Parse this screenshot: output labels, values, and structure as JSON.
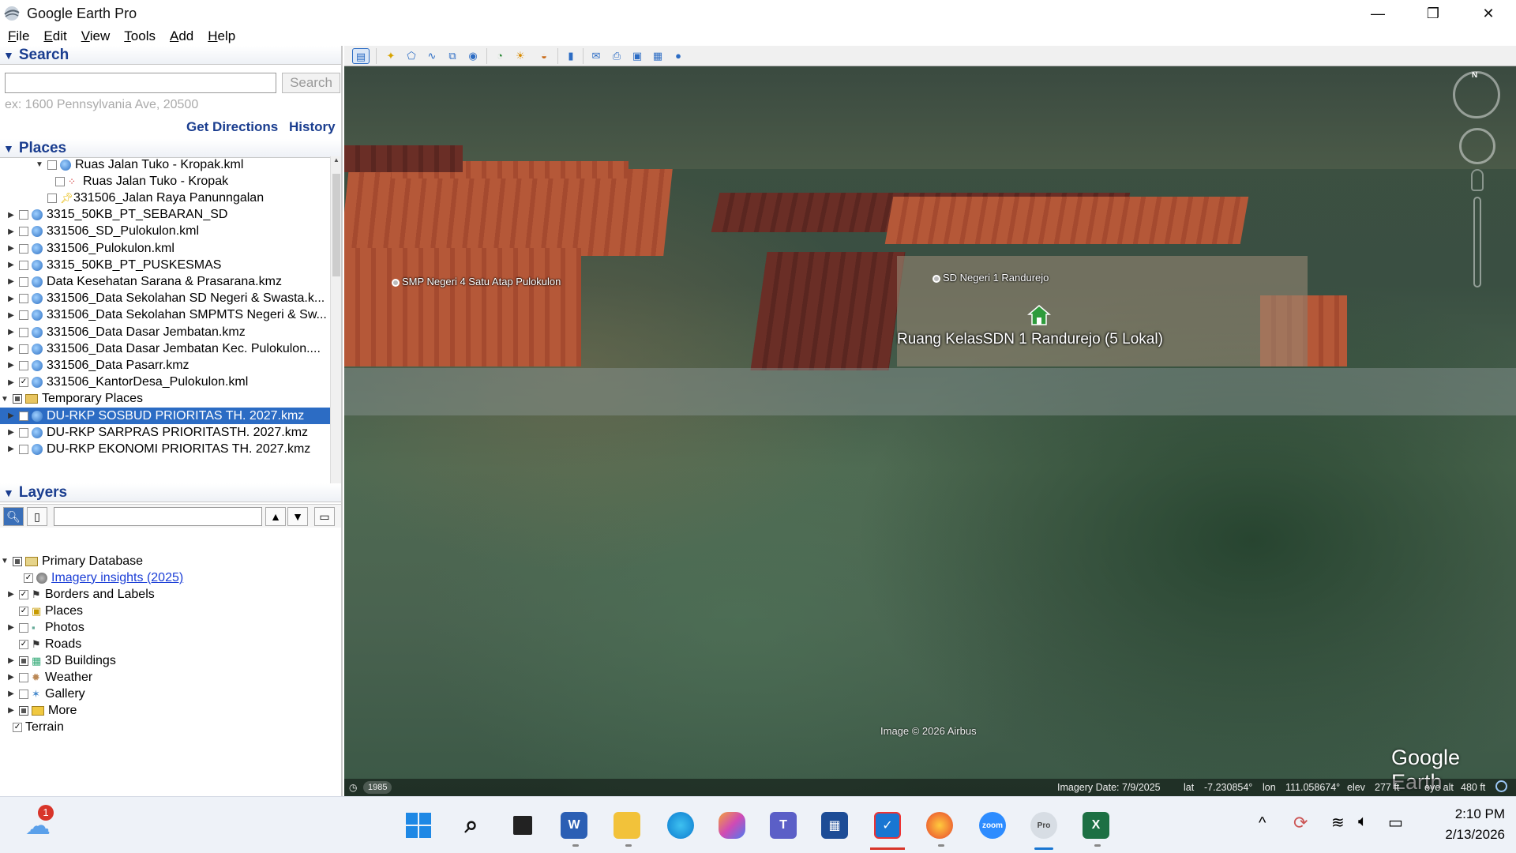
{
  "window": {
    "title": "Google Earth Pro",
    "minimize_glyph": "—",
    "maximize_glyph": "❐",
    "close_glyph": "✕"
  },
  "menu": [
    "File",
    "Edit",
    "View",
    "Tools",
    "Add",
    "Help"
  ],
  "search": {
    "header": "Search",
    "button": "Search",
    "placeholder": "ex: 1600 Pennsylvania Ave, 20500",
    "get_directions": "Get Directions",
    "history": "History"
  },
  "places": {
    "header": "Places",
    "items": [
      {
        "label": "Ruas Jalan Tuko - Kropak.kml",
        "icon": "kml-icon",
        "check": "off",
        "expand": "open"
      },
      {
        "label": "Ruas Jalan Tuko - Kropak",
        "icon": "path-icon",
        "check": "off",
        "expand": "none"
      },
      {
        "label": "331506_Jalan Raya Panunngalan",
        "icon": "pushpin-icon",
        "check": "off",
        "expand": "none"
      },
      {
        "label": "3315_50KB_PT_SEBARAN_SD",
        "icon": "kml-icon",
        "check": "off",
        "expand": "closed"
      },
      {
        "label": "331506_SD_Pulokulon.kml",
        "icon": "kml-icon",
        "check": "off",
        "expand": "closed"
      },
      {
        "label": "331506_Pulokulon.kml",
        "icon": "kml-icon",
        "check": "off",
        "expand": "closed"
      },
      {
        "label": "3315_50KB_PT_PUSKESMAS",
        "icon": "kml-icon",
        "check": "off",
        "expand": "closed"
      },
      {
        "label": "Data Kesehatan Sarana & Prasarana.kmz",
        "icon": "kml-icon",
        "check": "off",
        "expand": "closed"
      },
      {
        "label": "331506_Data Sekolahan SD Negeri & Swasta.k...",
        "icon": "kml-icon",
        "check": "off",
        "expand": "closed"
      },
      {
        "label": "331506_Data Sekolahan SMPMTS Negeri & Sw...",
        "icon": "kml-icon",
        "check": "off",
        "expand": "closed"
      },
      {
        "label": "331506_Data Dasar Jembatan.kmz",
        "icon": "kml-icon",
        "check": "off",
        "expand": "closed"
      },
      {
        "label": "331506_Data Dasar Jembatan Kec. Pulokulon....",
        "icon": "kml-icon",
        "check": "off",
        "expand": "closed"
      },
      {
        "label": "331506_Data Pasarr.kmz",
        "icon": "kml-icon",
        "check": "off",
        "expand": "closed"
      },
      {
        "label": "331506_KantorDesa_Pulokulon.kml",
        "icon": "kml-icon",
        "check": "on",
        "expand": "closed"
      },
      {
        "label": "Temporary Places",
        "icon": "folder-icon",
        "check": "part",
        "expand": "open"
      },
      {
        "label": "DU-RKP SOSBUD PRIORITAS TH. 2027.kmz",
        "icon": "kml-icon",
        "check": "on",
        "expand": "closed",
        "selected": true
      },
      {
        "label": "DU-RKP SARPRAS PRIORITASTH. 2027.kmz",
        "icon": "kml-icon",
        "check": "off",
        "expand": "closed"
      },
      {
        "label": "DU-RKP EKONOMI PRIORITAS TH. 2027.kmz",
        "icon": "kml-icon",
        "check": "off",
        "expand": "closed"
      }
    ]
  },
  "layers": {
    "header": "Layers",
    "items": [
      {
        "label": "Primary Database",
        "icon": "database-icon",
        "check": "part",
        "expand": "open"
      },
      {
        "label": "Imagery insights (2025)",
        "icon": "globe-icon",
        "check": "on",
        "expand": "none",
        "link": true
      },
      {
        "label": "Borders and Labels",
        "icon": "flag-icon",
        "check": "on",
        "expand": "closed"
      },
      {
        "label": "Places",
        "icon": "places-icon",
        "check": "on",
        "expand": "none"
      },
      {
        "label": "Photos",
        "icon": "photo-icon",
        "check": "off",
        "expand": "closed"
      },
      {
        "label": "Roads",
        "icon": "road-icon",
        "check": "on",
        "expand": "none"
      },
      {
        "label": "3D Buildings",
        "icon": "building-icon",
        "check": "part",
        "expand": "closed"
      },
      {
        "label": "Weather",
        "icon": "weather-icon",
        "check": "off",
        "expand": "closed"
      },
      {
        "label": "Gallery",
        "icon": "gallery-icon",
        "check": "off",
        "expand": "closed"
      },
      {
        "label": "More",
        "icon": "more-icon",
        "check": "part",
        "expand": "closed"
      },
      {
        "label": "Terrain",
        "icon": "none",
        "check": "on",
        "expand": "none"
      }
    ]
  },
  "map": {
    "labels": {
      "smp": "SMP Negeri 4 Satu Atap Pulokulon",
      "sd": "SD Negeri 1 Randurejo",
      "ruang": "Ruang KelasSDN 1 Randurejo (5 Lokal)"
    },
    "copyright": "Image © 2026 Airbus",
    "logo": "Google Earth",
    "compass_north": "N",
    "status": {
      "year": "1985",
      "imagery_date": "Imagery Date: 7/9/2025",
      "lat_label": "lat",
      "lat": "-7.230854°",
      "lon_label": "lon",
      "lon": "111.058674°",
      "elev_label": "elev",
      "elev": "277 ft",
      "eye_label": "eye alt",
      "eye": "480 ft"
    }
  },
  "taskbar": {
    "notification_badge": "1",
    "time": "2:10 PM",
    "date": "2/13/2026",
    "tray_up_arrow": "^"
  }
}
